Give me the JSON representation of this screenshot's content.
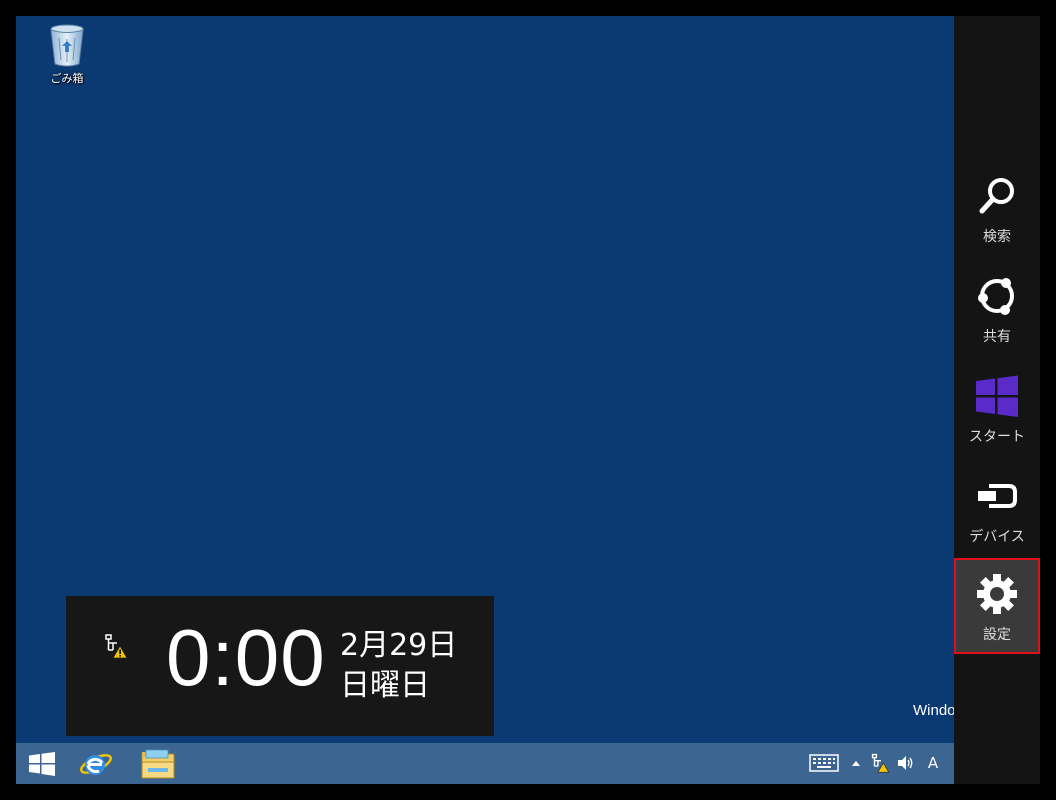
{
  "desktop": {
    "recycle_bin_label": "ごみ箱",
    "watermark_text": "Windo"
  },
  "clock": {
    "time": "0:00",
    "date_line1": "2月29日",
    "date_line2": "日曜日",
    "network_icon": "network-warning-icon"
  },
  "taskbar": {
    "apps": [
      "start-windows-icon",
      "internet-explorer-icon",
      "file-explorer-icon"
    ],
    "tray": {
      "keyboard_icon": "touch-keyboard-icon",
      "show_hidden_icon": "chevron-up-icon",
      "network_icon": "network-warning-icon",
      "volume_icon": "speaker-icon",
      "ime_label": "A"
    }
  },
  "charms": {
    "search_label": "検索",
    "share_label": "共有",
    "start_label": "スタート",
    "devices_label": "デバイス",
    "settings_label": "設定"
  },
  "colors": {
    "desktop_bg": "#0b3a73",
    "charms_bg": "#141414",
    "start_accent": "#5b2bc9",
    "selection_outline": "#e0101a"
  }
}
